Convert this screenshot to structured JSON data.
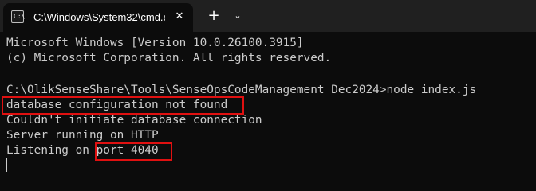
{
  "window": {
    "tab_title": "C:\\Windows\\System32\\cmd.e",
    "tab_icon_glyph": "C:\\",
    "close_glyph": "✕",
    "new_tab_glyph": "+",
    "dropdown_glyph": "⌄"
  },
  "terminal": {
    "lines": [
      "Microsoft Windows [Version 10.0.26100.3915]",
      "(c) Microsoft Corporation. All rights reserved.",
      "",
      "C:\\OlikSenseShare\\Tools\\SenseOpsCodeManagement_Dec2024>node index.js",
      "database configuration not found",
      "Couldn't initiate database connection",
      "Server running on HTTP",
      "Listening on port 4040"
    ],
    "highlight_color": "#e01010"
  },
  "icons": {
    "tab_icon": "cmd-icon",
    "close": "close-icon",
    "new_tab": "plus-icon",
    "dropdown": "chevron-down-icon"
  }
}
